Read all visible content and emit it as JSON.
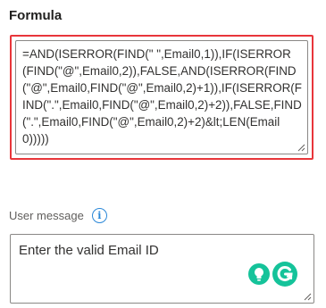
{
  "formula": {
    "label": "Formula",
    "value": "=AND(ISERROR(FIND(\" \",Email0,1)),IF(ISERROR(FIND(\"@\",Email0,2)),FALSE,AND(ISERROR(FIND(\"@\",Email0,FIND(\"@\",Email0,2)+1)),IF(ISERROR(FIND(\".\",Email0,FIND(\"@\",Email0,2)+2)),FALSE,FIND(\".\",Email0,FIND(\"@\",Email0,2)+2)&lt;LEN(Email0)))))"
  },
  "user_message": {
    "label": "User message",
    "info_glyph": "i",
    "value": "Enter the valid Email ID"
  },
  "icons": {
    "info": "info-circle-icon",
    "bulb": "lightbulb-icon",
    "grammarly": "grammarly-g-icon",
    "resize": "resize-grip-icon"
  },
  "colors": {
    "highlight_border": "#e8363b",
    "field_border": "#8a8886",
    "info_blue": "#2b88d8",
    "grammarly_green": "#15c39a"
  }
}
